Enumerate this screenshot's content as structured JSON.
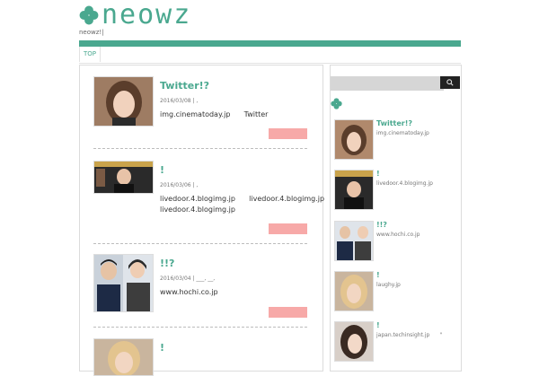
{
  "site": {
    "logo_text": "neowz",
    "tagline": "neowz!|"
  },
  "nav": {
    "tabs": [
      {
        "label": "TOP"
      }
    ]
  },
  "posts": [
    {
      "title": "Twitter!?",
      "date": "2016/03/08 | ,",
      "lines": [
        "img.cinematoday.jp      Twitter"
      ]
    },
    {
      "title": "!",
      "date": "2016/03/06 | ,",
      "lines": [
        "livedoor.4.blogimg.jp      livedoor.4.blogimg.jp",
        "livedoor.4.blogimg.jp"
      ]
    },
    {
      "title": "!!?",
      "date": "2016/03/04 | ___, __,",
      "lines": [
        "www.hochi.co.jp"
      ]
    },
    {
      "title": "!",
      "date": "",
      "lines": []
    }
  ],
  "sidebar": {
    "search_placeholder": "",
    "items": [
      {
        "title": "Twitter!?",
        "source": "img.cinematoday.jp"
      },
      {
        "title": "!",
        "source": "livedoor.4.blogimg.jp"
      },
      {
        "title": "!!?",
        "source": "www.hochi.co.jp"
      },
      {
        "title": "!",
        "source": "laughy.jp"
      },
      {
        "title": "!",
        "source": "japan.techinsight.jp      \""
      }
    ]
  },
  "colors": {
    "accent": "#4aa88f",
    "more_button": "#f7a9a8",
    "search_button": "#222222"
  },
  "icons": {
    "logo": "clover-icon",
    "search": "search-icon",
    "sidebar_heading": "clover-icon"
  }
}
